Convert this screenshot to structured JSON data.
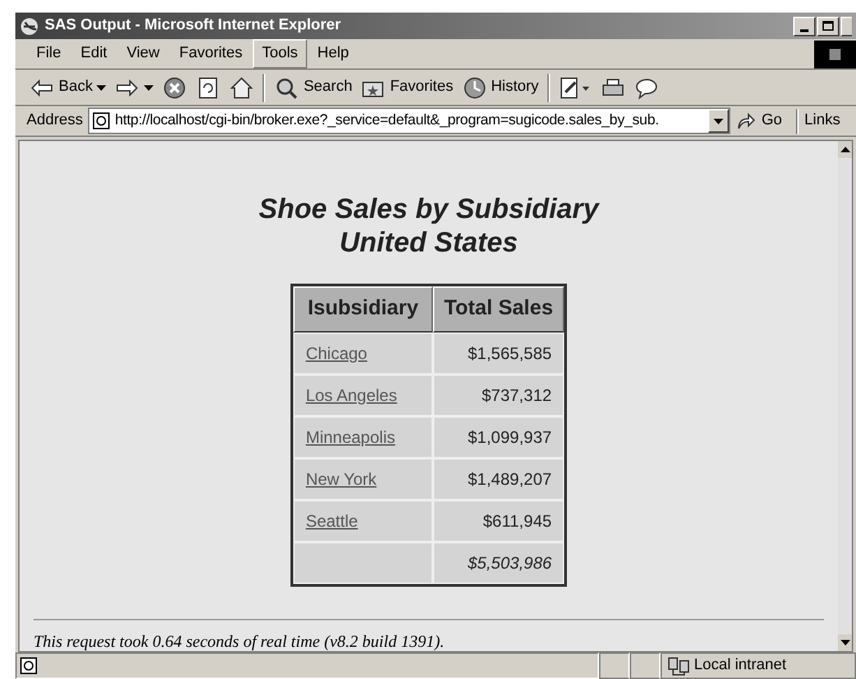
{
  "window": {
    "title": "SAS Output - Microsoft Internet Explorer"
  },
  "menu": [
    {
      "label": "File",
      "selected": false
    },
    {
      "label": "Edit",
      "selected": false
    },
    {
      "label": "View",
      "selected": false
    },
    {
      "label": "Favorites",
      "selected": false
    },
    {
      "label": "Tools",
      "selected": true
    },
    {
      "label": "Help",
      "selected": false
    }
  ],
  "toolbar": [
    {
      "kind": "back",
      "label": "Back"
    },
    {
      "kind": "forward"
    },
    {
      "kind": "stop"
    },
    {
      "kind": "refresh"
    },
    {
      "kind": "home"
    },
    {
      "kind": "sep"
    },
    {
      "kind": "search",
      "label": "Search"
    },
    {
      "kind": "favorites",
      "label": "Favorites"
    },
    {
      "kind": "history",
      "label": "History"
    },
    {
      "kind": "sep"
    },
    {
      "kind": "edit"
    },
    {
      "kind": "print"
    },
    {
      "kind": "discuss"
    }
  ],
  "address": {
    "label": "Address",
    "value": "http://localhost/cgi-bin/broker.exe?_service=default&_program=sugicode.sales_by_sub.",
    "go": "Go",
    "links": "Links"
  },
  "page": {
    "title": "Shoe Sales by Subsidiary",
    "subtitle": "United States",
    "table": {
      "columns": [
        "Isubsidiary",
        "Total Sales"
      ],
      "rows": [
        {
          "subsidiary": "Chicago",
          "sales": "$1,565,585"
        },
        {
          "subsidiary": "Los Angeles",
          "sales": "$737,312"
        },
        {
          "subsidiary": "Minneapolis",
          "sales": "$1,099,937"
        },
        {
          "subsidiary": "New York",
          "sales": "$1,489,207"
        },
        {
          "subsidiary": "Seattle",
          "sales": "$611,945"
        }
      ],
      "total": "$5,503,986"
    },
    "footer": "This request took 0.64 seconds of real time (v8.2 build 1391)."
  },
  "status_bar": {
    "zone": "Local intranet"
  }
}
